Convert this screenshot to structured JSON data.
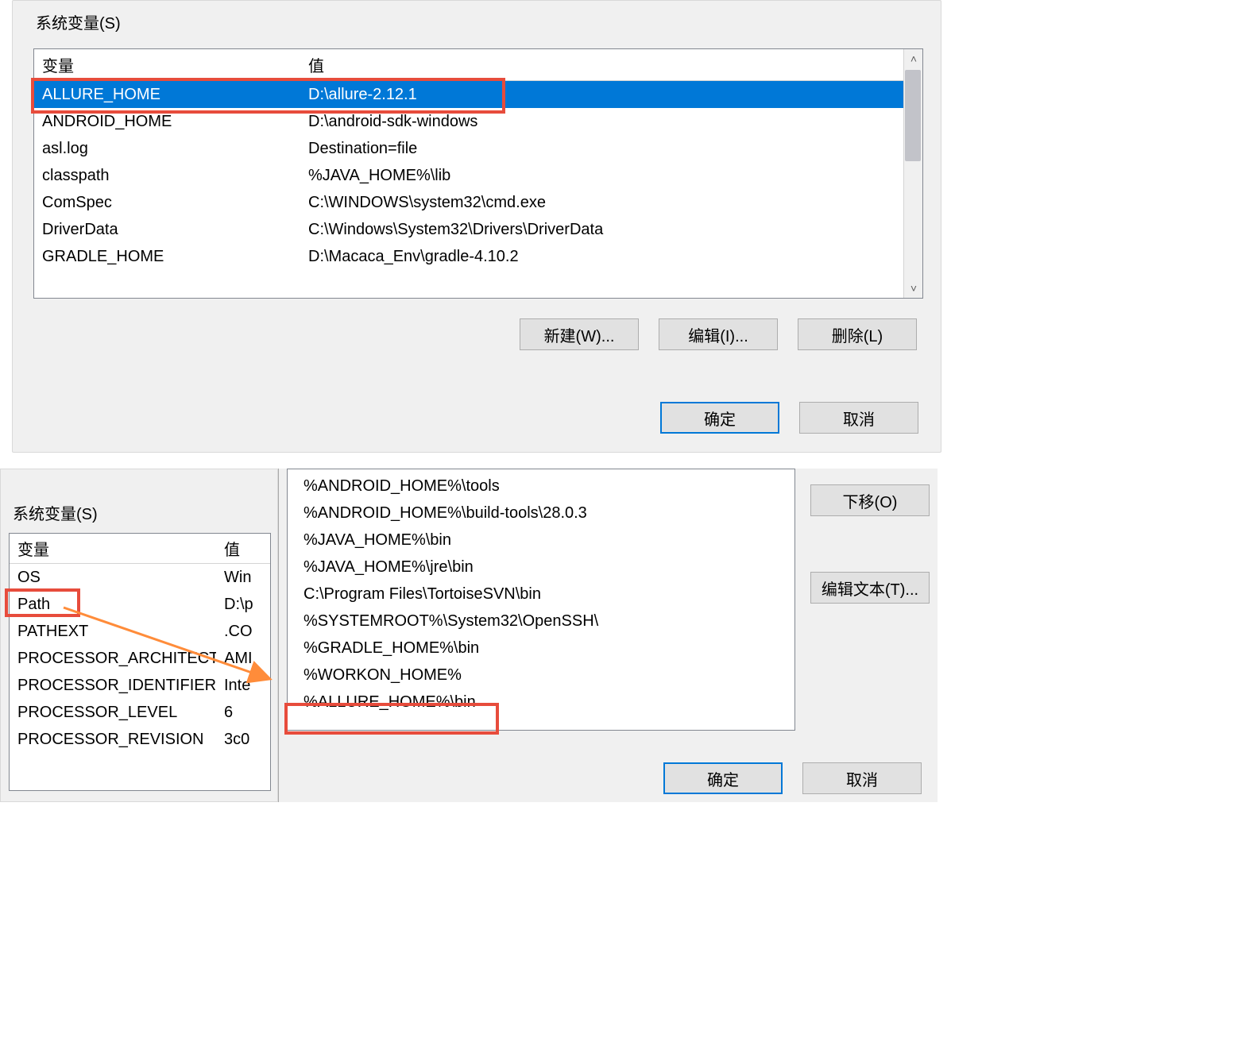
{
  "top": {
    "fieldset_label": "系统变量(S)",
    "col_var": "变量",
    "col_val": "值",
    "rows": [
      {
        "var": "ALLURE_HOME",
        "val": "D:\\allure-2.12.1"
      },
      {
        "var": "ANDROID_HOME",
        "val": "D:\\android-sdk-windows"
      },
      {
        "var": "asl.log",
        "val": "Destination=file"
      },
      {
        "var": "classpath",
        "val": "%JAVA_HOME%\\lib"
      },
      {
        "var": "ComSpec",
        "val": "C:\\WINDOWS\\system32\\cmd.exe"
      },
      {
        "var": "DriverData",
        "val": "C:\\Windows\\System32\\Drivers\\DriverData"
      },
      {
        "var": "GRADLE_HOME",
        "val": "D:\\Macaca_Env\\gradle-4.10.2"
      }
    ],
    "btn_new": "新建(W)...",
    "btn_edit": "编辑(I)...",
    "btn_delete": "删除(L)"
  },
  "global": {
    "ok": "确定",
    "cancel": "取消"
  },
  "bottom_left": {
    "fieldset_label": "系统变量(S)",
    "col_var": "变量",
    "col_val": "值",
    "rows": [
      {
        "var": "OS",
        "val": "Win"
      },
      {
        "var": "Path",
        "val": "D:\\p"
      },
      {
        "var": "PATHEXT",
        "val": ".CO"
      },
      {
        "var": "PROCESSOR_ARCHITECTURE",
        "val": "AMI"
      },
      {
        "var": "PROCESSOR_IDENTIFIER",
        "val": "Inte"
      },
      {
        "var": "PROCESSOR_LEVEL",
        "val": "6"
      },
      {
        "var": "PROCESSOR_REVISION",
        "val": "3c0"
      }
    ]
  },
  "path_dialog": {
    "entries": [
      "%ANDROID_HOME%\\tools",
      "%ANDROID_HOME%\\build-tools\\28.0.3",
      "%JAVA_HOME%\\bin",
      "%JAVA_HOME%\\jre\\bin",
      "C:\\Program Files\\TortoiseSVN\\bin",
      "%SYSTEMROOT%\\System32\\OpenSSH\\",
      "%GRADLE_HOME%\\bin",
      "%WORKON_HOME%",
      "%ALLURE_HOME%\\bin"
    ],
    "btn_movedown": "下移(O)",
    "btn_edittext": "编辑文本(T)...",
    "ok": "确定",
    "cancel": "取消"
  }
}
